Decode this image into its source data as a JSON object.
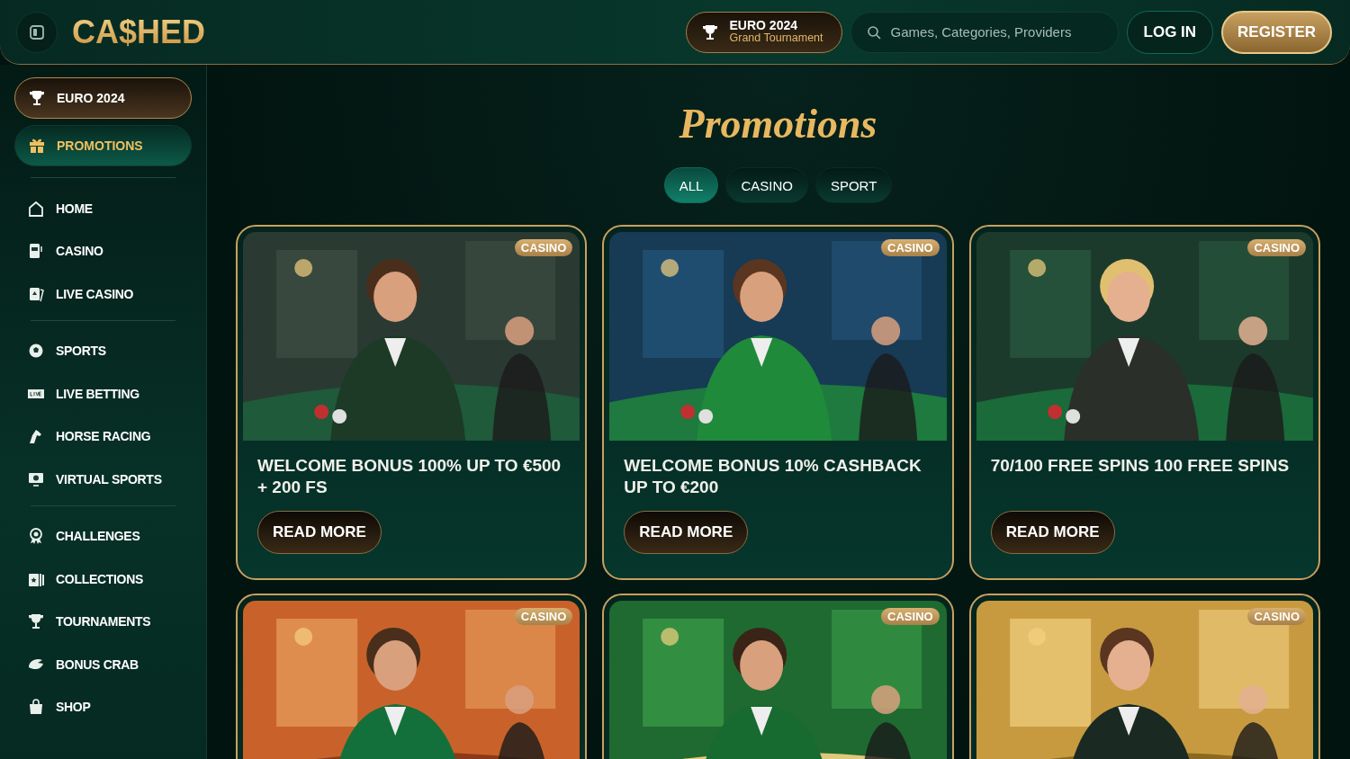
{
  "header": {
    "logo": "CA$HED",
    "event_pill": {
      "title": "EURO 2024",
      "subtitle": "Grand Tournament"
    },
    "search": {
      "placeholder": "Games, Categories, Providers"
    },
    "login": "LOG IN",
    "register": "REGISTER"
  },
  "sidebar": {
    "featured": [
      {
        "kind": "event",
        "label": "EURO 2024",
        "selected": false
      },
      {
        "kind": "promo",
        "label": "PROMOTIONS",
        "selected": true
      }
    ],
    "groups": [
      [
        {
          "label": "HOME",
          "selected": false
        },
        {
          "label": "CASINO",
          "selected": false
        },
        {
          "label": "LIVE CASINO",
          "selected": false
        }
      ],
      [
        {
          "label": "SPORTS",
          "selected": false
        },
        {
          "label": "LIVE BETTING",
          "selected": false
        },
        {
          "label": "HORSE RACING",
          "selected": false
        },
        {
          "label": "VIRTUAL SPORTS",
          "selected": false
        }
      ],
      [
        {
          "label": "CHALLENGES",
          "selected": false
        },
        {
          "label": "COLLECTIONS",
          "selected": false
        },
        {
          "label": "TOURNAMENTS",
          "selected": false
        },
        {
          "label": "BONUS CRAB",
          "selected": false
        },
        {
          "label": "SHOP",
          "selected": false
        }
      ]
    ]
  },
  "page_title": "Promotions",
  "tabs": [
    {
      "label": "ALL",
      "selected": true
    },
    {
      "label": "CASINO",
      "selected": false
    },
    {
      "label": "SPORT",
      "selected": false
    }
  ],
  "promotions": [
    {
      "tag": "CASINO",
      "title": "WELCOME BONUS 100% UP TO €500 + 200 FS",
      "button": "READ MORE"
    },
    {
      "tag": "CASINO",
      "title": "WELCOME BONUS 10% CASHBACK UP TO €200",
      "button": "READ MORE"
    },
    {
      "tag": "CASINO",
      "title": "70/100 FREE SPINS 100 FREE SPINS",
      "button": "READ MORE"
    },
    {
      "tag": "CASINO"
    },
    {
      "tag": "CASINO"
    },
    {
      "tag": "CASINO"
    }
  ]
}
